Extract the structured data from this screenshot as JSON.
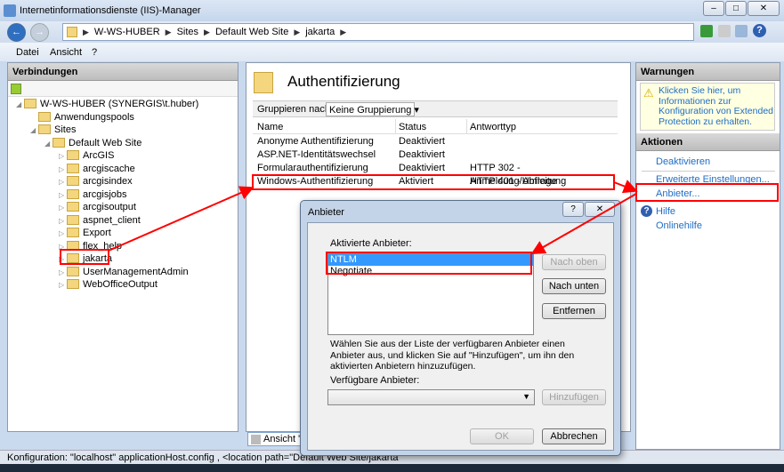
{
  "window": {
    "title": "Internetinformationsdienste (IIS)-Manager",
    "minimize": "–",
    "maximize": "□",
    "close": "✕"
  },
  "breadcrumb": [
    "W-WS-HUBER",
    "Sites",
    "Default Web Site",
    "jakarta"
  ],
  "menu": [
    "Datei",
    "Ansicht",
    "?"
  ],
  "connections": {
    "header": "Verbindungen",
    "tree": [
      {
        "label": "W-WS-HUBER (SYNERGIS\\t.huber)",
        "level": 0
      },
      {
        "label": "Anwendungspools",
        "level": 1
      },
      {
        "label": "Sites",
        "level": 1
      },
      {
        "label": "Default Web Site",
        "level": 2
      },
      {
        "label": "ArcGIS",
        "level": 3
      },
      {
        "label": "arcgiscache",
        "level": 3
      },
      {
        "label": "arcgisindex",
        "level": 3
      },
      {
        "label": "arcgisjobs",
        "level": 3
      },
      {
        "label": "arcgisoutput",
        "level": 3
      },
      {
        "label": "aspnet_client",
        "level": 3
      },
      {
        "label": "Export",
        "level": 3
      },
      {
        "label": "flex_help",
        "level": 3
      },
      {
        "label": "jakarta",
        "level": 3
      },
      {
        "label": "UserManagementAdmin",
        "level": 3
      },
      {
        "label": "WebOfficeOutput",
        "level": 3
      }
    ]
  },
  "main": {
    "title": "Authentifizierung",
    "group_label": "Gruppieren nach:",
    "group_value": "Keine Gruppierung",
    "columns": [
      "Name",
      "Status",
      "Antworttyp"
    ],
    "rows": [
      [
        "Anonyme Authentifizierung",
        "Deaktiviert",
        ""
      ],
      [
        "ASP.NET-Identitätswechsel",
        "Deaktiviert",
        ""
      ],
      [
        "Formularauthentifizierung",
        "Deaktiviert",
        "HTTP 302 - Anmeldung/Umleitung"
      ],
      [
        "Windows-Authentifizierung",
        "Aktiviert",
        "HTTP 401 - Abfrage"
      ]
    ],
    "view_tab": "Ansicht \"Fe"
  },
  "warnings": {
    "header": "Warnungen",
    "text": "Klicken Sie hier, um Informationen zur Konfiguration von Extended Protection zu erhalten."
  },
  "actions": {
    "header": "Aktionen",
    "items": [
      "Deaktivieren",
      "Erweiterte Einstellungen...",
      "Anbieter...",
      "Hilfe",
      "Onlinehilfe"
    ]
  },
  "status": "Konfiguration: \"localhost\" applicationHost.config , <location path=\"Default Web Site/jakarta\"",
  "dialog": {
    "title": "Anbieter",
    "help": "?",
    "close": "✕",
    "enabled_label": "Aktivierte Anbieter:",
    "enabled": [
      "NTLM",
      "Negotiate"
    ],
    "up": "Nach oben",
    "down": "Nach unten",
    "remove": "Entfernen",
    "hint": "Wählen Sie aus der Liste der verfügbaren Anbieter einen Anbieter aus, und klicken Sie auf \"Hinzufügen\", um ihn den aktivierten Anbietern hinzuzufügen.",
    "available_label": "Verfügbare Anbieter:",
    "available_value": "",
    "add": "Hinzufügen",
    "ok": "OK",
    "cancel": "Abbrechen"
  },
  "colors": {
    "highlight": "#ff0000",
    "selection": "#3399ff",
    "link": "#1f6dc5"
  }
}
